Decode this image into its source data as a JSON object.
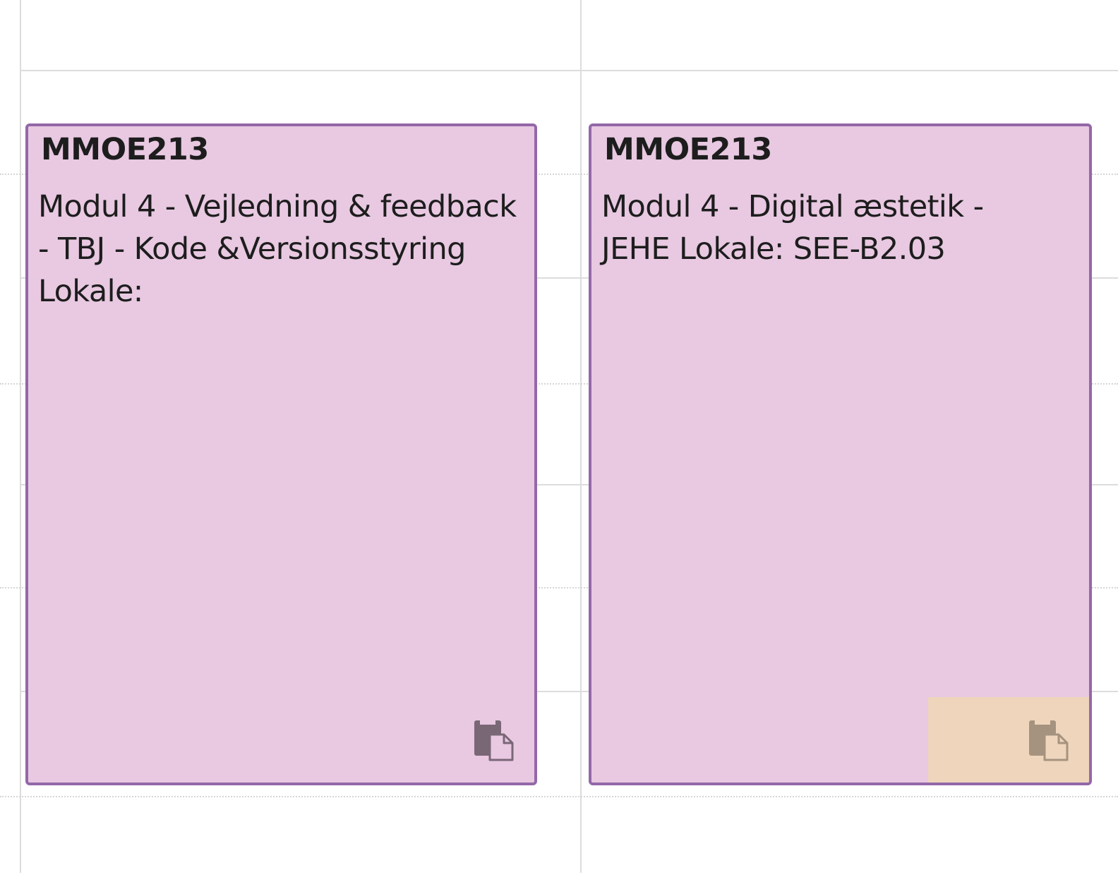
{
  "colors": {
    "event_background": "#e8c9e1",
    "event_border": "#9368a8",
    "highlight_background": "#eed5bb",
    "grid_line": "#dcdcdc",
    "icon": "#7a6776",
    "icon_on_highlight": "#a6937f"
  },
  "events": [
    {
      "code": "MMOE213",
      "description": "Modul 4 - Vejledning & feedback - TBJ - Kode &Versionsstyring Lokale:",
      "icon": "copy-icon"
    },
    {
      "code": "MMOE213",
      "description": "Modul 4 - Digital æstetik - JEHE Lokale: SEE-B2.03",
      "icon": "copy-icon"
    }
  ]
}
